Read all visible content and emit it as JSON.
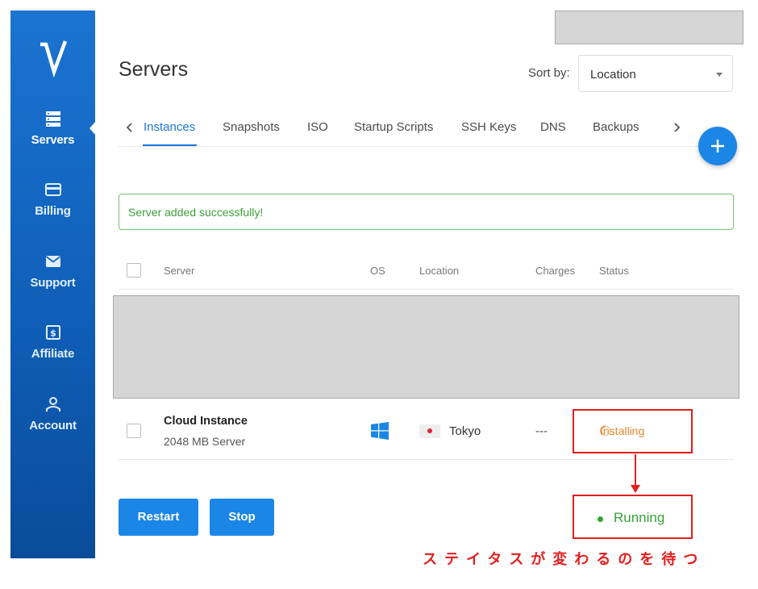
{
  "sidebar": {
    "logo_icon": "vultr-logo-icon",
    "items": [
      {
        "label": "Servers",
        "icon": "server-icon",
        "active": true
      },
      {
        "label": "Billing",
        "icon": "credit-card-icon"
      },
      {
        "label": "Support",
        "icon": "mail-icon"
      },
      {
        "label": "Affiliate",
        "icon": "dollar-icon"
      },
      {
        "label": "Account",
        "icon": "user-icon"
      }
    ],
    "color": "#1b74d1"
  },
  "header": {
    "title": "Servers",
    "sort_label": "Sort by:",
    "sort_value": "Location"
  },
  "tabs": [
    "Instances",
    "Snapshots",
    "ISO",
    "Startup Scripts",
    "SSH Keys",
    "DNS",
    "Backups"
  ],
  "active_tab": "Instances",
  "alert": {
    "text": "Server added successfully!",
    "color": "#3e9d3a"
  },
  "table": {
    "headers": {
      "server": "Server",
      "os": "OS",
      "location": "Location",
      "charges": "Charges",
      "status": "Status"
    },
    "rows": [
      {
        "name": "Cloud Instance",
        "size": "2048 MB Server",
        "os_icon": "windows-icon",
        "flag_icon": "japan-flag-icon",
        "location": "Tokyo",
        "charges": "---",
        "status": "Installing"
      }
    ]
  },
  "buttons": {
    "restart": "Restart",
    "stop": "Stop"
  },
  "annotation": {
    "after_status": "Running",
    "note": "ステイタスが変わるのを待つ",
    "color": "#e31e1e"
  }
}
